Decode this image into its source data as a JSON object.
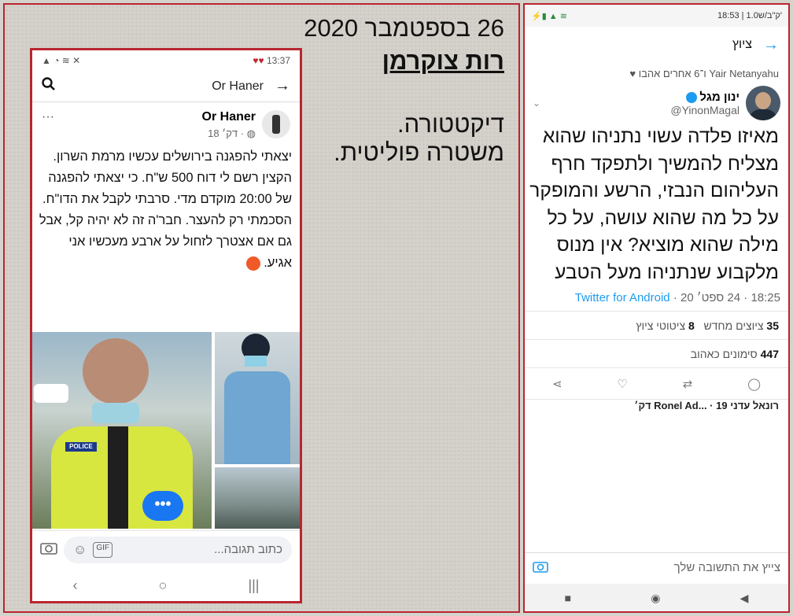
{
  "caption": {
    "date": "26 בספטמבר 2020",
    "author": "רות צוקרמן",
    "line1": "דיקטטורה.",
    "line2": "משטרה פוליטית."
  },
  "facebook": {
    "status_time": "13:37",
    "header_name": "Or Haner",
    "post_author": "Or Haner",
    "post_time": "18 דק׳ ·",
    "post_text": "יצאתי להפגנה בירושלים עכשיו מרמת השרון. הקצין רשם לי דוח 500 ש\"ח. כי יצאתי להפגנה של 20:00 מוקדם מדי. סרבתי לקבל את הדו\"ח. הסכמתי רק להעצר. חבר'ה זה לא יהיה קל, אבל גם אם אצטרך לזחול על ארבע מעכשיו אני אגיע.",
    "more_menu": "···",
    "photo_badge": "POLICE",
    "more_photos": "•••",
    "comment_placeholder": "כתוב תגובה...",
    "gif_label": "GIF"
  },
  "twitter": {
    "status_left": "18:53 | 1.0ק\"ב/ש'",
    "header_title": "ציוץ",
    "liked_by": "Yair Netanyahu ו־6 אחרים אהבו",
    "author_name": "ינון מגל",
    "author_handle": "@YinonMagal",
    "tweet_text": "מאיזו פלדה עשוי נתניהו שהוא מצליח להמשיך ולתפקד חרף העליהום הנבזי, הרשע והמופקר על כל מה שהוא עושה, על כל מילה שהוא מוציא? אין מנוס מלקבוע שנתניהו מעל הטבע",
    "time": "18:25 · 24 ספט׳ 20 · ",
    "source": "Twitter for Android",
    "retweets_count": "35",
    "retweets_label": "ציוצים מחדש",
    "quotes_count": "8",
    "quotes_label": "ציטוטי ציוץ",
    "likes_count": "447",
    "likes_label": "סימונים כאהוב",
    "reply_preview": "רונאל עדני  Ronel Ad... · 19 דק׳",
    "reply_placeholder": "צייץ את התשובה שלך"
  },
  "colors": {
    "frame_red": "#b8262f",
    "twitter_blue": "#1d9bf0",
    "facebook_blue": "#1a77f2"
  }
}
